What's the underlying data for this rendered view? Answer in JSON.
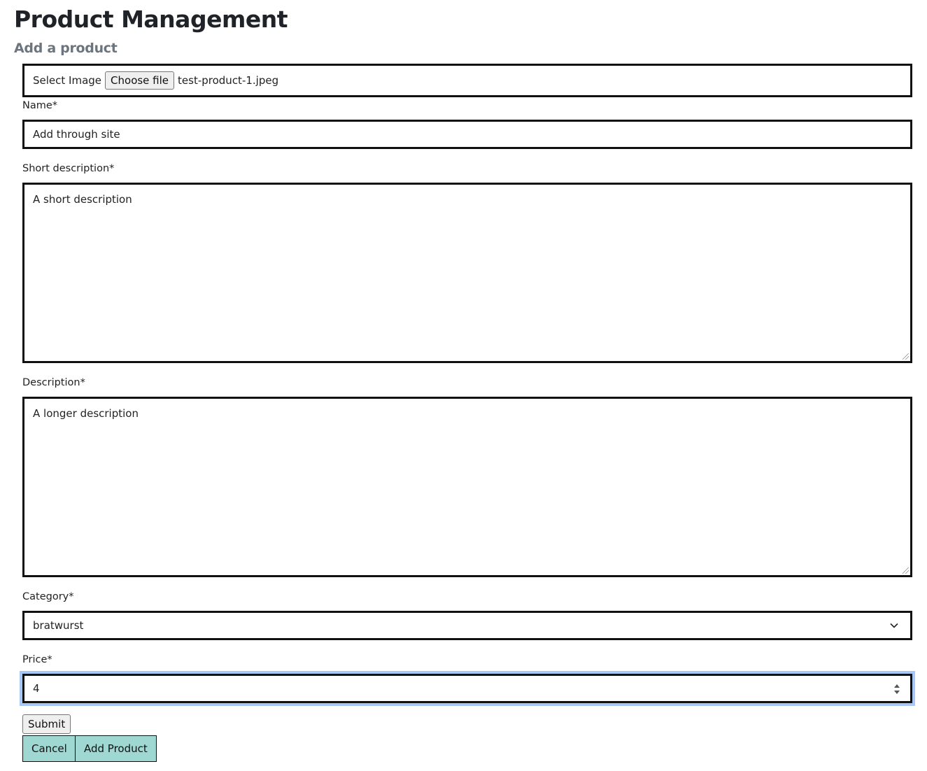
{
  "header": {
    "title": "Product Management",
    "subtitle": "Add a product"
  },
  "form": {
    "image": {
      "label": "Select Image",
      "button_label": "Choose file",
      "file_name": "test-product-1.jpeg"
    },
    "name": {
      "label": "Name*",
      "value": "Add through site"
    },
    "short_description": {
      "label": "Short description*",
      "value": "A short description"
    },
    "description": {
      "label": "Description*",
      "value": "A longer description"
    },
    "category": {
      "label": "Category*",
      "selected": "bratwurst",
      "icon": "chevron-down-icon"
    },
    "price": {
      "label": "Price*",
      "value": "4",
      "focused": true,
      "icon": "spinner-icon"
    },
    "submit_label": "Submit"
  },
  "actions": {
    "cancel_label": "Cancel",
    "add_product_label": "Add Product",
    "button_color": "#9fd8d2"
  },
  "colors": {
    "focus_ring": "#a7c7f7",
    "subtitle": "#6c757d"
  }
}
